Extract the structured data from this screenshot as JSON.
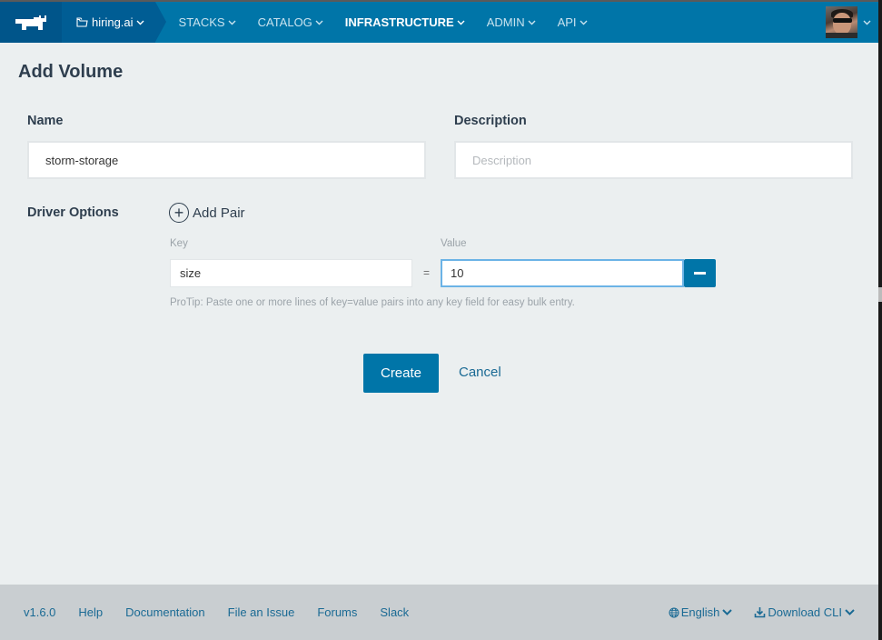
{
  "header": {
    "environment": "hiring.ai",
    "nav": [
      {
        "label": "STACKS",
        "active": false
      },
      {
        "label": "CATALOG",
        "active": false
      },
      {
        "label": "INFRASTRUCTURE",
        "active": true
      },
      {
        "label": "ADMIN",
        "active": false
      },
      {
        "label": "API",
        "active": false
      }
    ],
    "brand_color": "#0075a8"
  },
  "page": {
    "title": "Add Volume"
  },
  "form": {
    "name_label": "Name",
    "name_value": "storm-storage",
    "description_label": "Description",
    "description_value": "",
    "description_placeholder": "Description",
    "driver_options_label": "Driver Options",
    "add_pair_label": "Add Pair",
    "key_label": "Key",
    "value_label": "Value",
    "pairs": [
      {
        "key": "size",
        "value": "10"
      }
    ],
    "equals": "=",
    "protip": "ProTip: Paste one or more lines of key=value pairs into any key field for easy bulk entry.",
    "create_label": "Create",
    "cancel_label": "Cancel"
  },
  "footer": {
    "version": "v1.6.0",
    "links": [
      "Help",
      "Documentation",
      "File an Issue",
      "Forums",
      "Slack"
    ],
    "language": "English",
    "download": "Download CLI"
  }
}
